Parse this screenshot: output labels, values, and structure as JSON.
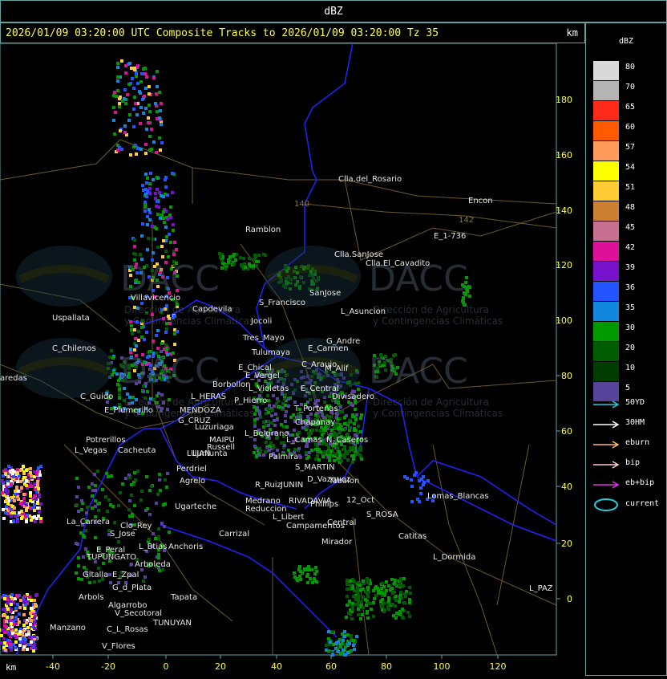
{
  "header": {
    "product": "dBZ",
    "title": "2026/01/09 03:20:00 UTC Composite Tracks to 2026/01/09 03:20:00 Tz 35",
    "units_top": "km",
    "units_bottom": "km"
  },
  "legend": {
    "title": "dBZ",
    "scale": [
      {
        "value": "80",
        "color": "#d9d9d9"
      },
      {
        "value": "70",
        "color": "#b4b4b4"
      },
      {
        "value": "65",
        "color": "#ff2a1a"
      },
      {
        "value": "60",
        "color": "#ff5a00"
      },
      {
        "value": "57",
        "color": "#ff9a5a"
      },
      {
        "value": "54",
        "color": "#ffff00"
      },
      {
        "value": "51",
        "color": "#ffcc33"
      },
      {
        "value": "48",
        "color": "#cc8033"
      },
      {
        "value": "45",
        "color": "#c87090"
      },
      {
        "value": "42",
        "color": "#dd1199"
      },
      {
        "value": "39",
        "color": "#7711cc"
      },
      {
        "value": "36",
        "color": "#2255ff"
      },
      {
        "value": "35",
        "color": "#1188dd"
      },
      {
        "value": "30",
        "color": "#009900"
      },
      {
        "value": "20",
        "color": "#005c00"
      },
      {
        "value": "10",
        "color": "#003d00"
      },
      {
        "value": "5",
        "color": "#554499"
      }
    ],
    "tracks": [
      {
        "label": "50YD",
        "color": "#22ccdd"
      },
      {
        "label": "30HM",
        "color": "#ffffff"
      },
      {
        "label": "eburn",
        "color": "#ffbb66"
      },
      {
        "label": "bip",
        "color": "#ffcccc"
      },
      {
        "label": "eb+bip",
        "color": "#dd33dd"
      }
    ],
    "current_label": "current",
    "current_color": "#22ccdd"
  },
  "axes": {
    "y_ticks": [
      "180",
      "160",
      "140",
      "120",
      "100",
      "80",
      "60",
      "40",
      "20",
      "0"
    ],
    "x_ticks": [
      "-40",
      "-20",
      "0",
      "20",
      "40",
      "60",
      "80",
      "100",
      "120"
    ]
  },
  "watermark": {
    "brand": "DACC",
    "line1": "Dirección de Agricultura",
    "line2": "y Contingencias Climáticas"
  },
  "places": [
    "Clla.del_Rosario",
    "Encon",
    "E_1-736",
    "Ramblon",
    "Clla.SanJose",
    "Clla.El_Cavadito",
    "Villavicencio",
    "Capdevila",
    "S_Francisco",
    "SanJose",
    "L_Asuncion",
    "Uspallata",
    "Tres_Mayo",
    "Jocoli",
    "C_Chilenos",
    "Tulumaya",
    "G_Andre",
    "E_Carmen",
    "E_Chical",
    "C_Araujo",
    "M_Alif",
    "E_Vergel",
    "Borbollon",
    "L_Violetas",
    "E_Central",
    "Divisadero",
    "P_Hierro",
    "C_Guido",
    "L_HERAS",
    "T_Porteñas",
    "E_Plumerillo",
    "MENDOZA",
    "G_CRUZ",
    "Luzuriaga",
    "L_Belgrano",
    "Chapanay",
    "MAIPU",
    "Lunlunta",
    "Russell",
    "L_Camas",
    "N_Caseros",
    "Potrerillos",
    "Cacheuta",
    "L_Vegas",
    "LUJAN",
    "S_MARTIN",
    "Perdriel",
    "Palmira",
    "Agrelo",
    "R_Ruiz",
    "JUNIN",
    "D_Vazquez",
    "Tabalon",
    "Ugarteche",
    "Medrano",
    "RIVADAVIA",
    "Phillips",
    "12_Oct",
    "S_ROSA",
    "Lomas_Blancas",
    "Reduccion",
    "L_Libert",
    "Central",
    "La_Carrera",
    "Clo_Rey",
    "Carrizal",
    "S_Jose",
    "Campamentos",
    "E_Peral",
    "L_Btias",
    "Anchoris",
    "Catitas",
    "TUPUNGATO",
    "Arboleda",
    "Mirador",
    "L_Dormida",
    "Gltalla",
    "E_Zpal",
    "G_d_Plata",
    "Arbols",
    "Tapata",
    "L_PAZ",
    "Algarrobo",
    "V_Secotoral",
    "TUNUYAN",
    "Manzano",
    "C_L_Rosas",
    "V_Flores",
    "aredas",
    "140",
    "142"
  ]
}
